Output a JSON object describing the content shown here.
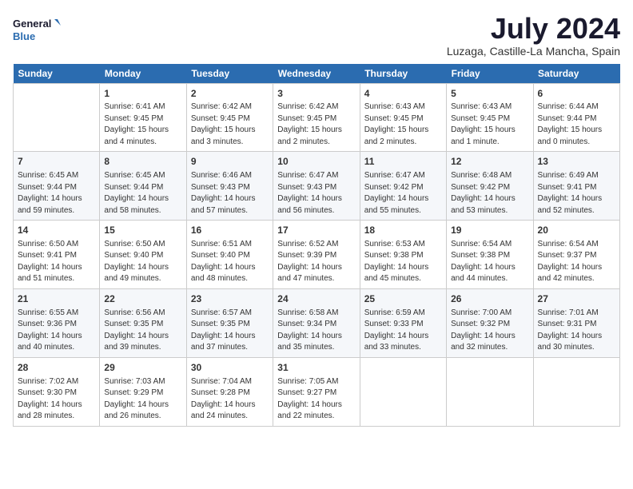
{
  "logo": {
    "line1": "General",
    "line2": "Blue"
  },
  "title": "July 2024",
  "location": "Luzaga, Castille-La Mancha, Spain",
  "headers": [
    "Sunday",
    "Monday",
    "Tuesday",
    "Wednesday",
    "Thursday",
    "Friday",
    "Saturday"
  ],
  "weeks": [
    [
      {
        "day": "",
        "info": ""
      },
      {
        "day": "1",
        "info": "Sunrise: 6:41 AM\nSunset: 9:45 PM\nDaylight: 15 hours\nand 4 minutes."
      },
      {
        "day": "2",
        "info": "Sunrise: 6:42 AM\nSunset: 9:45 PM\nDaylight: 15 hours\nand 3 minutes."
      },
      {
        "day": "3",
        "info": "Sunrise: 6:42 AM\nSunset: 9:45 PM\nDaylight: 15 hours\nand 2 minutes."
      },
      {
        "day": "4",
        "info": "Sunrise: 6:43 AM\nSunset: 9:45 PM\nDaylight: 15 hours\nand 2 minutes."
      },
      {
        "day": "5",
        "info": "Sunrise: 6:43 AM\nSunset: 9:45 PM\nDaylight: 15 hours\nand 1 minute."
      },
      {
        "day": "6",
        "info": "Sunrise: 6:44 AM\nSunset: 9:44 PM\nDaylight: 15 hours\nand 0 minutes."
      }
    ],
    [
      {
        "day": "7",
        "info": "Sunrise: 6:45 AM\nSunset: 9:44 PM\nDaylight: 14 hours\nand 59 minutes."
      },
      {
        "day": "8",
        "info": "Sunrise: 6:45 AM\nSunset: 9:44 PM\nDaylight: 14 hours\nand 58 minutes."
      },
      {
        "day": "9",
        "info": "Sunrise: 6:46 AM\nSunset: 9:43 PM\nDaylight: 14 hours\nand 57 minutes."
      },
      {
        "day": "10",
        "info": "Sunrise: 6:47 AM\nSunset: 9:43 PM\nDaylight: 14 hours\nand 56 minutes."
      },
      {
        "day": "11",
        "info": "Sunrise: 6:47 AM\nSunset: 9:42 PM\nDaylight: 14 hours\nand 55 minutes."
      },
      {
        "day": "12",
        "info": "Sunrise: 6:48 AM\nSunset: 9:42 PM\nDaylight: 14 hours\nand 53 minutes."
      },
      {
        "day": "13",
        "info": "Sunrise: 6:49 AM\nSunset: 9:41 PM\nDaylight: 14 hours\nand 52 minutes."
      }
    ],
    [
      {
        "day": "14",
        "info": "Sunrise: 6:50 AM\nSunset: 9:41 PM\nDaylight: 14 hours\nand 51 minutes."
      },
      {
        "day": "15",
        "info": "Sunrise: 6:50 AM\nSunset: 9:40 PM\nDaylight: 14 hours\nand 49 minutes."
      },
      {
        "day": "16",
        "info": "Sunrise: 6:51 AM\nSunset: 9:40 PM\nDaylight: 14 hours\nand 48 minutes."
      },
      {
        "day": "17",
        "info": "Sunrise: 6:52 AM\nSunset: 9:39 PM\nDaylight: 14 hours\nand 47 minutes."
      },
      {
        "day": "18",
        "info": "Sunrise: 6:53 AM\nSunset: 9:38 PM\nDaylight: 14 hours\nand 45 minutes."
      },
      {
        "day": "19",
        "info": "Sunrise: 6:54 AM\nSunset: 9:38 PM\nDaylight: 14 hours\nand 44 minutes."
      },
      {
        "day": "20",
        "info": "Sunrise: 6:54 AM\nSunset: 9:37 PM\nDaylight: 14 hours\nand 42 minutes."
      }
    ],
    [
      {
        "day": "21",
        "info": "Sunrise: 6:55 AM\nSunset: 9:36 PM\nDaylight: 14 hours\nand 40 minutes."
      },
      {
        "day": "22",
        "info": "Sunrise: 6:56 AM\nSunset: 9:35 PM\nDaylight: 14 hours\nand 39 minutes."
      },
      {
        "day": "23",
        "info": "Sunrise: 6:57 AM\nSunset: 9:35 PM\nDaylight: 14 hours\nand 37 minutes."
      },
      {
        "day": "24",
        "info": "Sunrise: 6:58 AM\nSunset: 9:34 PM\nDaylight: 14 hours\nand 35 minutes."
      },
      {
        "day": "25",
        "info": "Sunrise: 6:59 AM\nSunset: 9:33 PM\nDaylight: 14 hours\nand 33 minutes."
      },
      {
        "day": "26",
        "info": "Sunrise: 7:00 AM\nSunset: 9:32 PM\nDaylight: 14 hours\nand 32 minutes."
      },
      {
        "day": "27",
        "info": "Sunrise: 7:01 AM\nSunset: 9:31 PM\nDaylight: 14 hours\nand 30 minutes."
      }
    ],
    [
      {
        "day": "28",
        "info": "Sunrise: 7:02 AM\nSunset: 9:30 PM\nDaylight: 14 hours\nand 28 minutes."
      },
      {
        "day": "29",
        "info": "Sunrise: 7:03 AM\nSunset: 9:29 PM\nDaylight: 14 hours\nand 26 minutes."
      },
      {
        "day": "30",
        "info": "Sunrise: 7:04 AM\nSunset: 9:28 PM\nDaylight: 14 hours\nand 24 minutes."
      },
      {
        "day": "31",
        "info": "Sunrise: 7:05 AM\nSunset: 9:27 PM\nDaylight: 14 hours\nand 22 minutes."
      },
      {
        "day": "",
        "info": ""
      },
      {
        "day": "",
        "info": ""
      },
      {
        "day": "",
        "info": ""
      }
    ]
  ]
}
